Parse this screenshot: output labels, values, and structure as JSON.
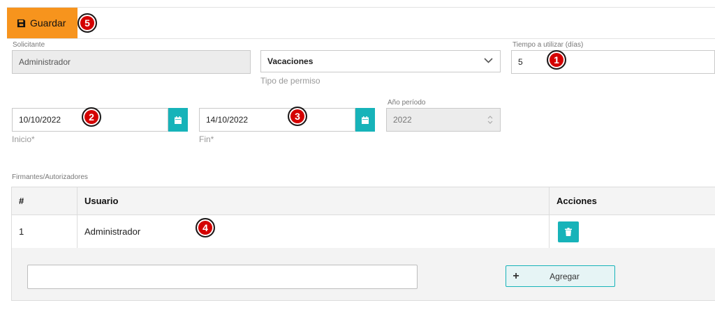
{
  "toolbar": {
    "save_label": "Guardar"
  },
  "badges": [
    "1",
    "2",
    "3",
    "4",
    "5"
  ],
  "form": {
    "solicitante": {
      "label": "Solicitante",
      "value": "Administrador"
    },
    "tipo_permiso": {
      "value": "Vacaciones",
      "help": "Tipo de permiso"
    },
    "tiempo": {
      "label": "Tiempo a utilizar (días)",
      "value": "5"
    },
    "inicio": {
      "value": "10/10/2022",
      "help": "Inicio*"
    },
    "fin": {
      "value": "14/10/2022",
      "help": "Fin*"
    },
    "anio_periodo": {
      "label": "Año período",
      "value": "2022"
    }
  },
  "firmantes": {
    "label": "Firmantes/Autorizadores",
    "columns": [
      "#",
      "Usuario",
      "Acciones"
    ],
    "rows": [
      {
        "num": "1",
        "usuario": "Administrador"
      }
    ],
    "add_label": "Agregar"
  },
  "colors": {
    "accent_orange": "#f7941d",
    "teal": "#17b3b9",
    "badge_red": "#d40000"
  }
}
